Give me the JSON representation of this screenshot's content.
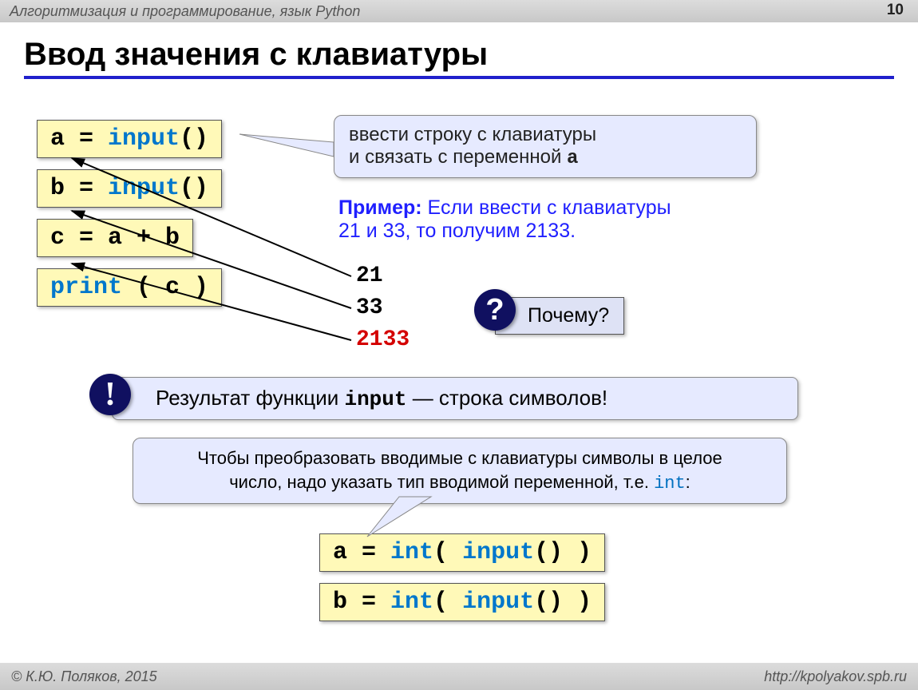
{
  "header": {
    "subject": "Алгоритмизация и программирование,  язык Python",
    "page": "10"
  },
  "title": "Ввод значения с клавиатуры",
  "code": {
    "line1_a": "a",
    "line1_eq": " = ",
    "line1_b": "input",
    "line1_c": "()",
    "line2_a": "b",
    "line2_eq": " = ",
    "line2_b": "input",
    "line2_c": "()",
    "line3": "c = a + b",
    "line4_a": "print",
    "line4_b": " ( c )",
    "int1_a": "a",
    "int1_eq": " = ",
    "int1_b": "int",
    "int1_c": "( ",
    "int1_d": "input",
    "int1_e": "() )",
    "int2_a": "b",
    "int2_eq": " = ",
    "int2_b": "int",
    "int2_c": "( ",
    "int2_d": "input",
    "int2_e": "() )"
  },
  "speech1": {
    "l1": "ввести строку с клавиатуры",
    "l2": "и связать с переменной ",
    "var": "a"
  },
  "example": {
    "label": "Пример:",
    "text1": " Если ввести с клавиатуры",
    "text2": "21 и 33, то получим 2133."
  },
  "output": {
    "v1": "21",
    "v2": "33",
    "v3": "2133"
  },
  "question": {
    "mark": "?",
    "text": "Почему?"
  },
  "info": {
    "mark": "!",
    "pre": "Результат функции ",
    "fn": "input",
    "post": " — строка символов!"
  },
  "conv": {
    "l1": "Чтобы преобразовать вводимые с клавиатуры символы в целое",
    "l2": "число, надо указать тип вводимой переменной, т.е. ",
    "kw": "int",
    "colon": ":"
  },
  "footer": {
    "left": "© К.Ю. Поляков, 2015",
    "right": "http://kpolyakov.spb.ru"
  }
}
